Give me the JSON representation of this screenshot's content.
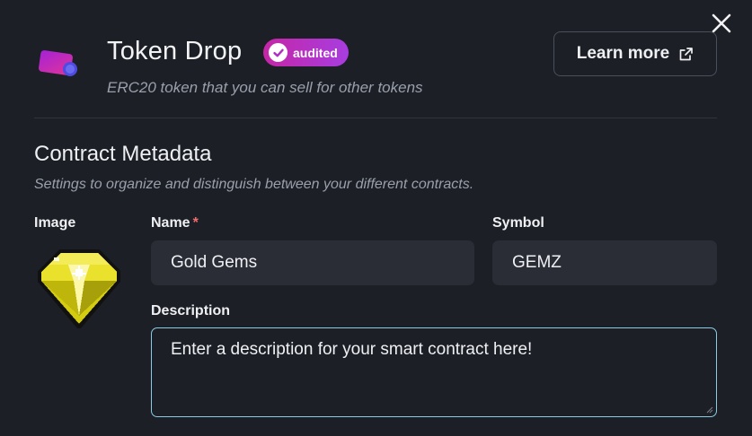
{
  "header": {
    "title": "Token Drop",
    "badge": "audited",
    "subtitle": "ERC20 token that you can sell for other tokens",
    "learn_more": "Learn more"
  },
  "section": {
    "title": "Contract Metadata",
    "subtitle": "Settings to organize and distinguish between your different contracts."
  },
  "form": {
    "image_label": "Image",
    "name_label": "Name",
    "required_mark": "*",
    "name_value": "Gold Gems",
    "symbol_label": "Symbol",
    "symbol_value": "GEMZ",
    "description_label": "Description",
    "description_placeholder": "Enter a description for your smart contract here!"
  },
  "colors": {
    "background": "#1c1f26",
    "input_bg": "#2a2d35",
    "badge_gradient_start": "#c526a6",
    "badge_gradient_end": "#a83de0",
    "focus_border": "#8ccbe8",
    "required": "#f26d6d"
  },
  "icons": {
    "close": "close-icon",
    "token": "token-drop-icon",
    "badge": "check-circle-icon",
    "external": "external-link-icon",
    "image": "gem-image"
  }
}
